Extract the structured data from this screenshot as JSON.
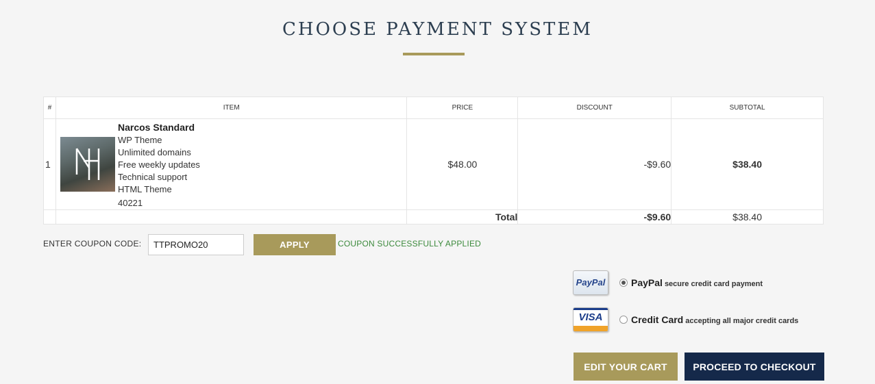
{
  "page": {
    "title": "CHOOSE PAYMENT SYSTEM"
  },
  "table": {
    "headers": {
      "num": "#",
      "item": "ITEM",
      "price": "PRICE",
      "discount": "DISCOUNT",
      "subtotal": "SUBTOTAL"
    },
    "rows": [
      {
        "num": "1",
        "name": "Narcos Standard",
        "features": [
          "WP Theme",
          "Unlimited domains",
          "Free weekly updates",
          "Technical support",
          "HTML Theme"
        ],
        "sku": "40221",
        "price": "$48.00",
        "discount": "-$9.60",
        "subtotal": "$38.40"
      }
    ],
    "total": {
      "label": "Total",
      "discount": "-$9.60",
      "subtotal": "$38.40"
    }
  },
  "coupon": {
    "label": "ENTER COUPON CODE:",
    "value": "TTPROMO20",
    "apply_label": "APPLY",
    "message": "COUPON SUCCESSFULLY APPLIED"
  },
  "payment": {
    "options": [
      {
        "name": "PayPal",
        "description": "secure credit card payment",
        "logo_text": "PayPal",
        "selected": true
      },
      {
        "name": "Credit Card",
        "description": "accepting all major credit cards",
        "logo_text": "VISA",
        "selected": false
      }
    ]
  },
  "actions": {
    "edit_label": "EDIT YOUR CART",
    "checkout_label": "PROCEED TO CHECKOUT"
  },
  "colors": {
    "accent": "#a89a5b",
    "primary_dark": "#15294a",
    "discount_red": "#c9453b",
    "success_green": "#3c8a3c"
  }
}
